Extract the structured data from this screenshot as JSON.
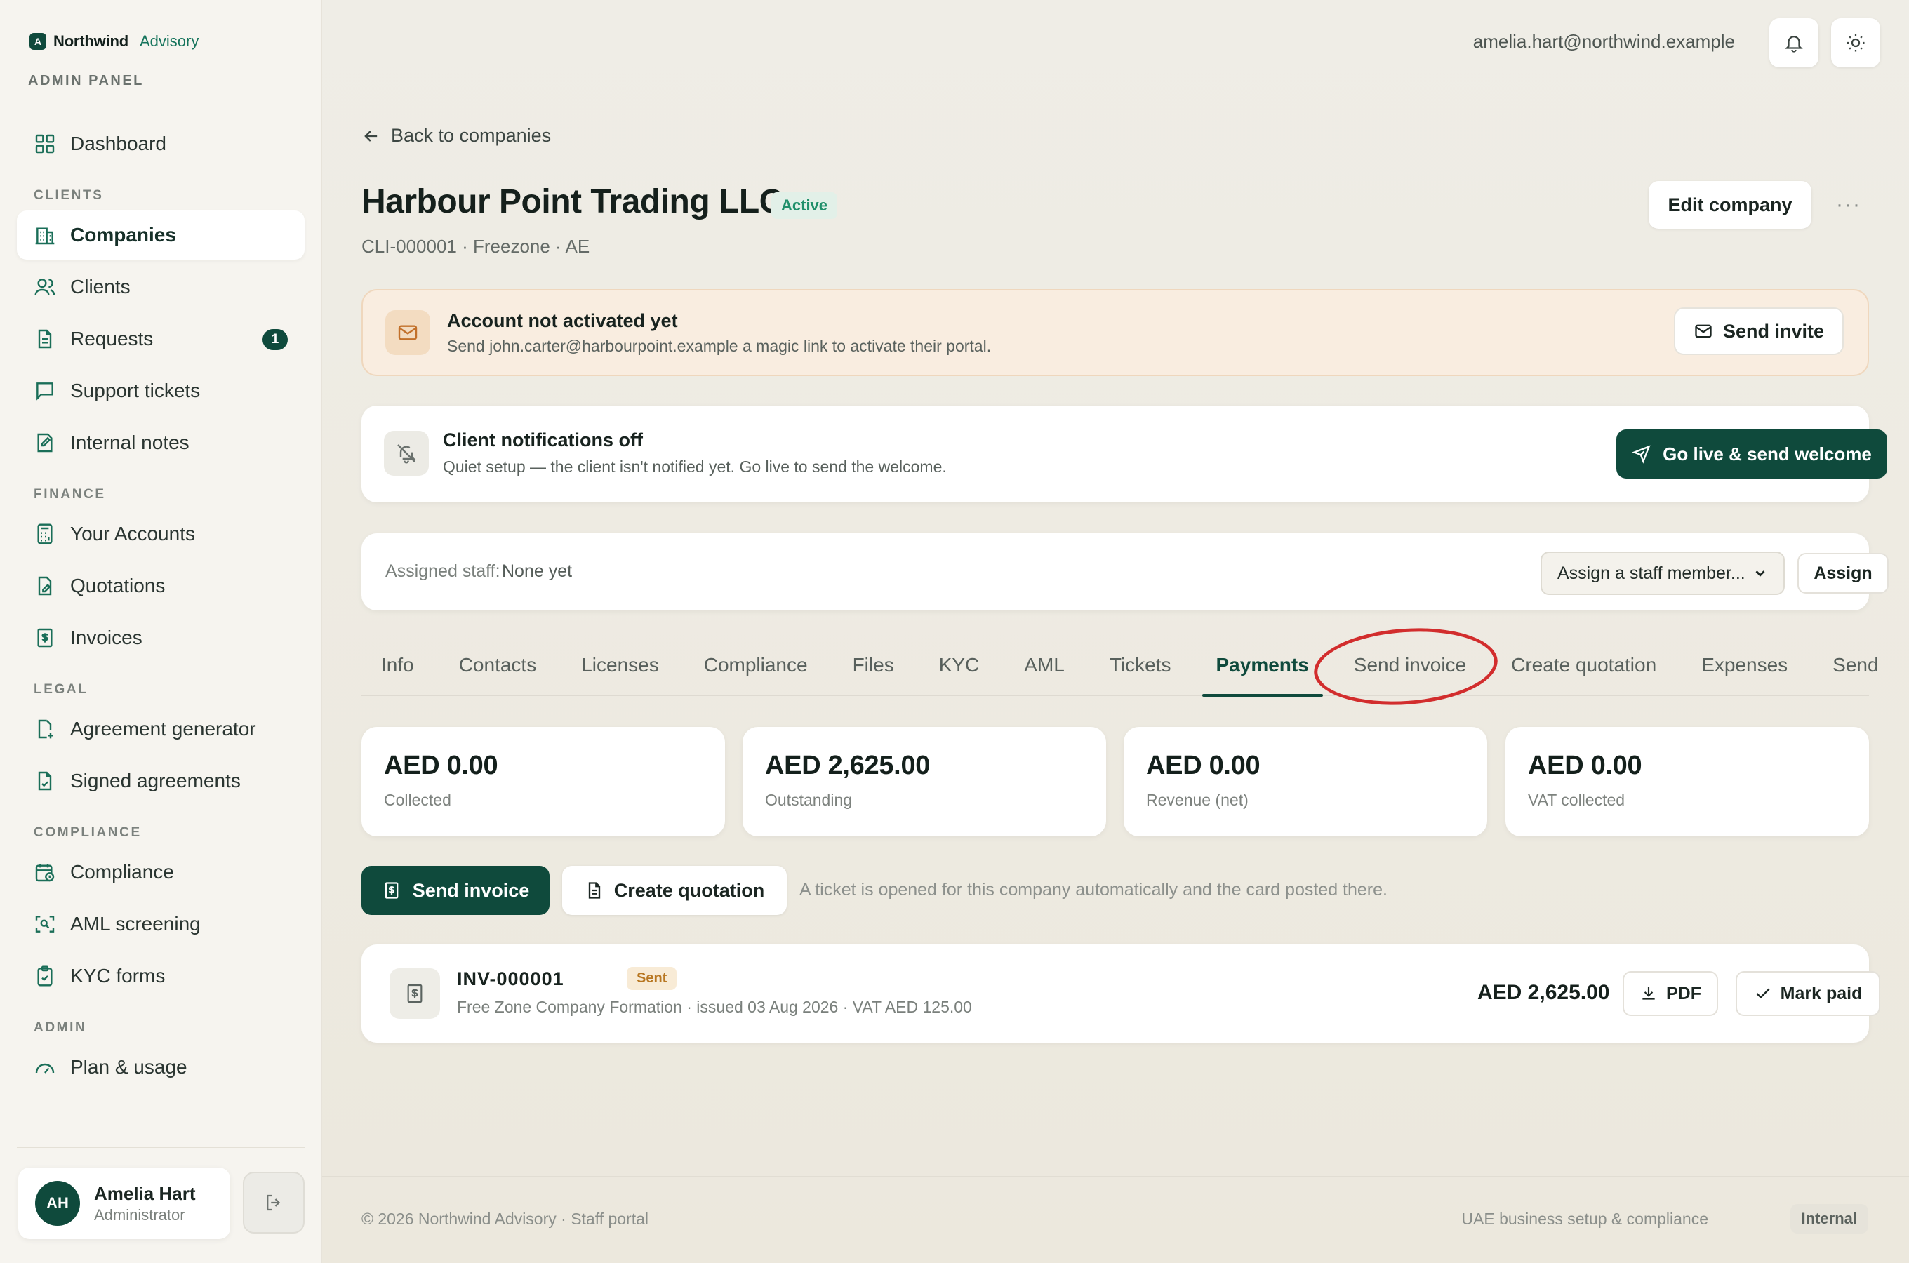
{
  "brand": {
    "mark": "A",
    "name": "Northwind",
    "accent": "Advisory",
    "panel_label": "ADMIN PANEL"
  },
  "sidebar": {
    "sections": [
      {
        "label": "",
        "items": [
          {
            "label": "Dashboard",
            "icon": "dashboard-icon"
          }
        ]
      },
      {
        "label": "CLIENTS",
        "items": [
          {
            "label": "Companies",
            "icon": "building-icon",
            "active": true
          },
          {
            "label": "Clients",
            "icon": "users-icon"
          },
          {
            "label": "Requests",
            "icon": "document-icon",
            "badge": "1"
          },
          {
            "label": "Support tickets",
            "icon": "chat-icon"
          },
          {
            "label": "Internal notes",
            "icon": "note-icon"
          }
        ]
      },
      {
        "label": "FINANCE",
        "items": [
          {
            "label": "Your Accounts",
            "icon": "calculator-icon"
          },
          {
            "label": "Quotations",
            "icon": "quote-icon"
          },
          {
            "label": "Invoices",
            "icon": "receipt-icon"
          }
        ]
      },
      {
        "label": "LEGAL",
        "items": [
          {
            "label": "Agreement generator",
            "icon": "file-plus-icon"
          },
          {
            "label": "Signed agreements",
            "icon": "file-check-icon"
          }
        ]
      },
      {
        "label": "COMPLIANCE",
        "items": [
          {
            "label": "Compliance",
            "icon": "calendar-check-icon"
          },
          {
            "label": "AML screening",
            "icon": "scan-icon"
          },
          {
            "label": "KYC forms",
            "icon": "clipboard-icon"
          }
        ]
      },
      {
        "label": "ADMIN",
        "items": [
          {
            "label": "Plan & usage",
            "icon": "gauge-icon"
          }
        ]
      }
    ],
    "user": {
      "initials": "AH",
      "name": "Amelia Hart",
      "role": "Administrator"
    }
  },
  "topbar": {
    "email": "amelia.hart@northwind.example"
  },
  "page": {
    "back_label": "Back to companies",
    "title": "Harbour Point Trading LLC",
    "status": "Active",
    "subtitle": "CLI-000001 · Freezone · AE",
    "edit_label": "Edit company",
    "more_label": "···"
  },
  "activation": {
    "title": "Account not activated yet",
    "desc": "Send john.carter@harbourpoint.example a magic link to activate their portal.",
    "button": "Send invite"
  },
  "notifications": {
    "title": "Client notifications off",
    "desc": "Quiet setup — the client isn't notified yet. Go live to send the welcome.",
    "button": "Go live & send welcome"
  },
  "staff": {
    "label": "Assigned staff:",
    "value": "None yet",
    "select_placeholder": "Assign a staff member...",
    "assign_label": "Assign"
  },
  "tabs": [
    "Info",
    "Contacts",
    "Licenses",
    "Compliance",
    "Files",
    "KYC",
    "AML",
    "Tickets",
    "Payments",
    "Send invoice",
    "Create quotation",
    "Expenses",
    "Send"
  ],
  "active_tab": "Payments",
  "stats": [
    {
      "value": "AED 0.00",
      "label": "Collected"
    },
    {
      "value": "AED 2,625.00",
      "label": "Outstanding"
    },
    {
      "value": "AED 0.00",
      "label": "Revenue (net)"
    },
    {
      "value": "AED 0.00",
      "label": "VAT collected"
    }
  ],
  "actions": {
    "send_invoice": "Send invoice",
    "create_quotation": "Create quotation",
    "hint": "A ticket is opened for this company automatically and the card posted there."
  },
  "invoice": {
    "number": "INV-000001",
    "status": "Sent",
    "desc": "Free Zone Company Formation · issued 03 Aug 2026 · VAT AED 125.00",
    "amount": "AED 2,625.00",
    "pdf_label": "PDF",
    "paid_label": "Mark paid"
  },
  "footer": {
    "left": "© 2026 Northwind Advisory · Staff portal",
    "right": "UAE business setup & compliance",
    "badge": "Internal"
  },
  "colors": {
    "primary": "#0f4a3c",
    "accent": "#16745c",
    "warn_bg": "#f9ede0",
    "highlight": "#d22d2d"
  }
}
